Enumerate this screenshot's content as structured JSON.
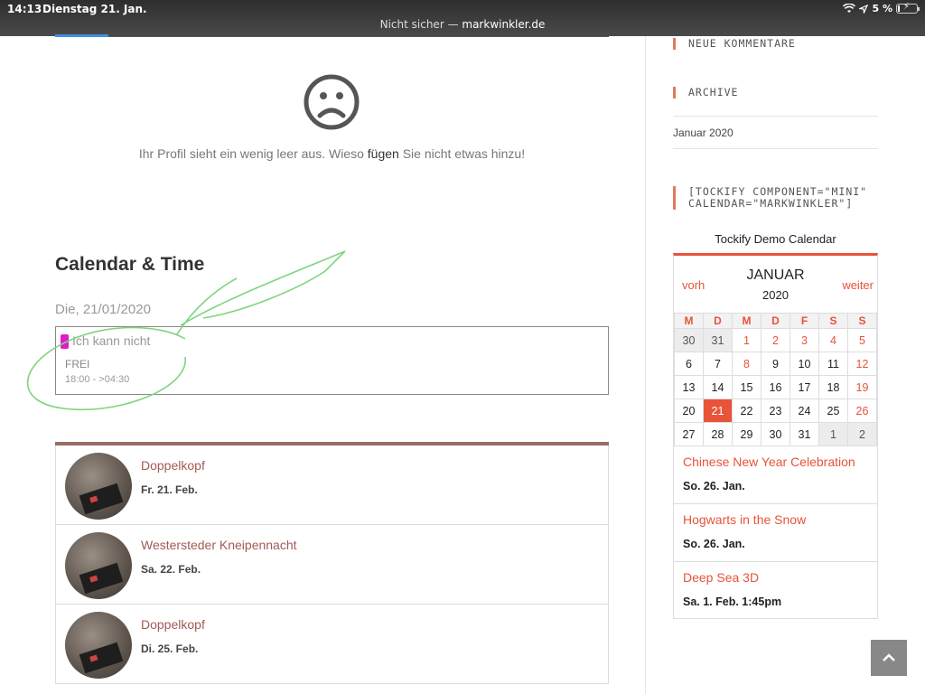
{
  "statusbar": {
    "time": "14:13",
    "date": "Dienstag 21. Jan.",
    "url_prefix": "Nicht sicher — ",
    "url_host": "markwinkler.de",
    "battery": "5 %"
  },
  "profile": {
    "text_before": "Ihr Profil sieht ein wenig leer aus. Wieso ",
    "text_link": "fügen",
    "text_after": " Sie nicht etwas hinzu!"
  },
  "calendar_section": {
    "title": "Calendar & Time",
    "date": "Die, 21/01/2020",
    "event": {
      "title": "Ich kann nicht",
      "status": "FREI",
      "time": "18:00 - >04:30",
      "color": "#e01cc8"
    }
  },
  "upcoming": [
    {
      "title": "Doppelkopf",
      "date": "Fr. 21. Feb."
    },
    {
      "title": "Westersteder Kneipennacht",
      "date": "Sa. 22. Feb."
    },
    {
      "title": "Doppelkopf",
      "date": "Di. 25. Feb."
    }
  ],
  "sidebar": {
    "comments_heading": "NEUE KOMMENTARE",
    "archive_heading": "ARCHIVE",
    "archive_item": "Januar 2020",
    "tockify_heading": "[TOCKIFY COMPONENT=\"MINI\" CALENDAR=\"MARKWINKLER\"]",
    "calendar": {
      "title": "Tockify Demo Calendar",
      "prev": "vorh",
      "next": "weiter",
      "month": "JANUAR",
      "year": "2020",
      "weekdays": [
        "M",
        "D",
        "M",
        "D",
        "F",
        "S",
        "S"
      ],
      "weeks": [
        [
          "30",
          "31",
          "1",
          "2",
          "3",
          "4",
          "5"
        ],
        [
          "6",
          "7",
          "8",
          "9",
          "10",
          "11",
          "12"
        ],
        [
          "13",
          "14",
          "15",
          "16",
          "17",
          "18",
          "19"
        ],
        [
          "20",
          "21",
          "22",
          "23",
          "24",
          "25",
          "26"
        ],
        [
          "27",
          "28",
          "29",
          "30",
          "31",
          "1",
          "2"
        ]
      ],
      "events": [
        {
          "title": "Chinese New Year Celebration",
          "date": "So. 26. Jan."
        },
        {
          "title": "Hogwarts in the Snow",
          "date": "So. 26. Jan."
        },
        {
          "title": "Deep Sea 3D",
          "date": "Sa. 1. Feb. 1:45pm"
        }
      ],
      "accent_color": "#e8533a"
    }
  },
  "icons": {
    "sad_face": "sad-face-icon",
    "scroll_top": "chevron-up-icon",
    "wifi": "wifi-icon",
    "location": "location-arrow-icon",
    "battery": "battery-icon"
  }
}
